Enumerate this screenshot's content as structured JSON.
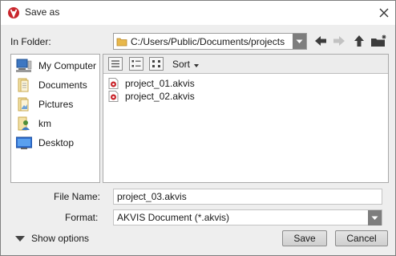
{
  "window": {
    "title": "Save as",
    "app_icon": "akvis-logo-icon",
    "close_icon": "close-icon"
  },
  "location": {
    "label": "In Folder:",
    "path": "C:/Users/Public/Documents/projects",
    "nav_icons": [
      "back-arrow-icon",
      "forward-arrow-icon",
      "up-folder-icon",
      "new-folder-icon"
    ]
  },
  "places": [
    {
      "label": "My Computer",
      "icon": "computer-icon"
    },
    {
      "label": "Documents",
      "icon": "documents-icon"
    },
    {
      "label": "Pictures",
      "icon": "pictures-icon"
    },
    {
      "label": "km",
      "icon": "user-folder-icon"
    },
    {
      "label": "Desktop",
      "icon": "desktop-icon"
    }
  ],
  "toolbar": {
    "view_icons": [
      "list-view-icon",
      "detail-view-icon",
      "icon-view-icon"
    ],
    "sort_label": "Sort"
  },
  "files": [
    {
      "name": "project_01.akvis",
      "icon": "akvis-file-icon"
    },
    {
      "name": "project_02.akvis",
      "icon": "akvis-file-icon"
    }
  ],
  "filename": {
    "label": "File Name:",
    "value": "project_03.akvis"
  },
  "format": {
    "label": "Format:",
    "value": "AKVIS Document (*.akvis)"
  },
  "footer": {
    "show_options_label": "Show options",
    "save_label": "Save",
    "cancel_label": "Cancel"
  },
  "colors": {
    "accent_blue": "#1c63c9",
    "folder_yellow": "#e8b84b",
    "akvis_red": "#c9262c",
    "dialog_bg": "#eeeeee"
  }
}
